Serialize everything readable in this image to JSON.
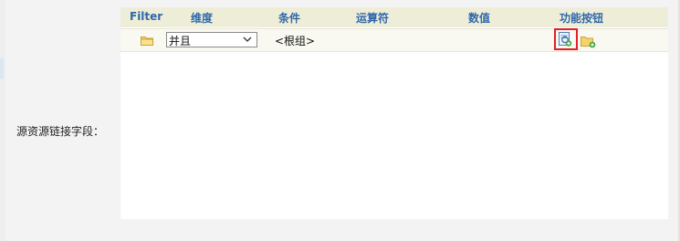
{
  "form": {
    "field_label": "源资源链接字段："
  },
  "grid": {
    "columns": [
      "Filter",
      "维度",
      "条件",
      "运算符",
      "数值",
      "功能按钮"
    ],
    "rows": [
      {
        "logic_value": "并且",
        "condition": "<根组>",
        "operator": "",
        "value": ""
      }
    ]
  },
  "icons": {
    "folder": "folder-icon",
    "dropdown": "chevron-down-icon",
    "edit": "edit-condition-icon",
    "add_group": "add-folder-icon"
  },
  "colors": {
    "header_bg": "#eeeed8",
    "header_text": "#2f67a9",
    "highlight": "#e1202a"
  }
}
